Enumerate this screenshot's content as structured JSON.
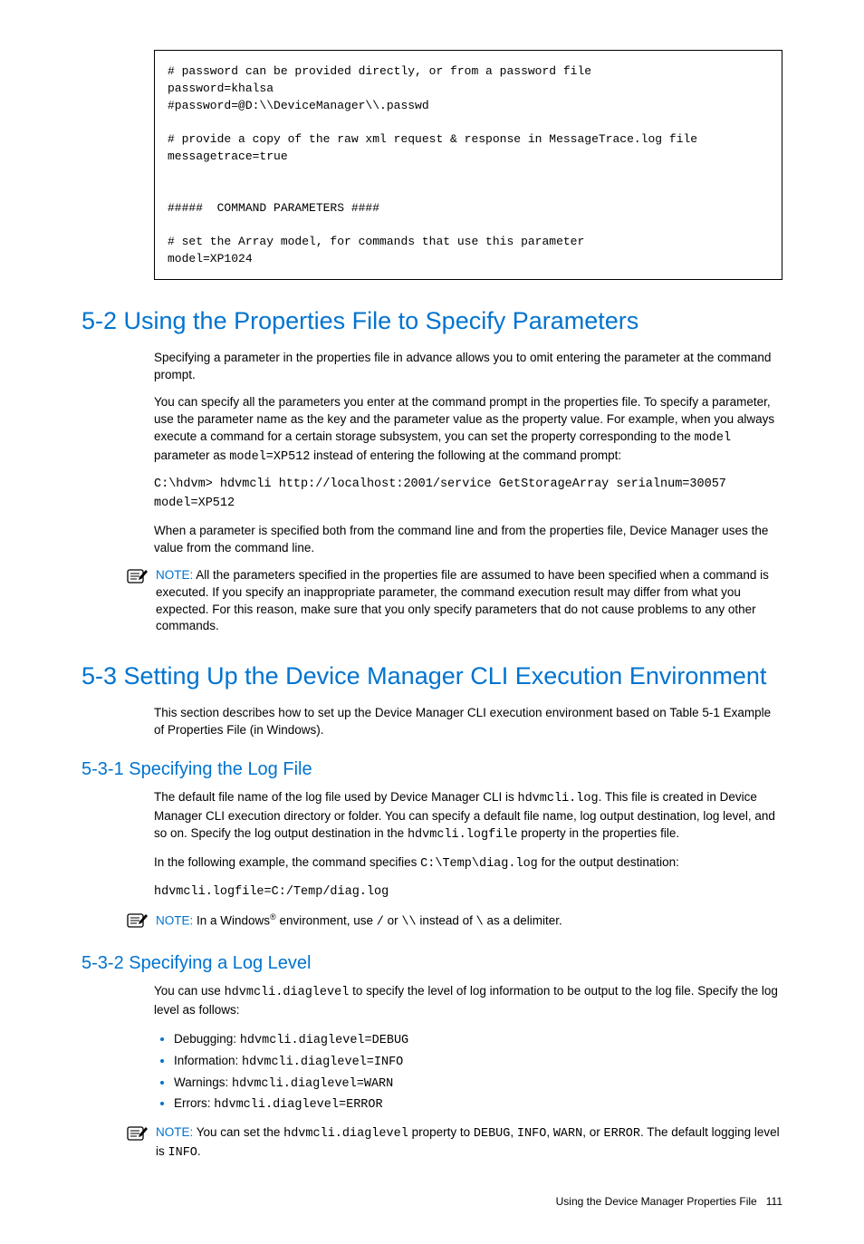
{
  "codebox": "# password can be provided directly, or from a password file\npassword=khalsa\n#password=@D:\\\\DeviceManager\\\\.passwd\n\n# provide a copy of the raw xml request & response in MessageTrace.log file\nmessagetrace=true\n\n\n#####  COMMAND PARAMETERS ####\n\n# set the Array model, for commands that use this parameter\nmodel=XP1024",
  "h52": "5-2 Using the Properties File to Specify Parameters",
  "p52_1": "Specifying a parameter in the properties file in advance allows you to omit entering the parameter at the command prompt.",
  "p52_2a": "You can specify all the parameters you enter at the command prompt in the properties file. To specify a parameter, use the parameter name as the key and the parameter value as the property value. For example, when you always execute a command for a certain storage subsystem, you can set the property corresponding to the ",
  "p52_2_model": "model",
  "p52_2b": " parameter as ",
  "p52_2_modelval": "model=XP512",
  "p52_2c": " instead of entering the following at the command prompt:",
  "cmd52": "C:\\hdvm> hdvmcli http://localhost:2001/service GetStorageArray serialnum=30057 model=XP512",
  "p52_3": "When a parameter is specified both from the command line and from the properties file, Device Manager uses the value from the command line.",
  "note52_label": "NOTE:  ",
  "note52": "All the parameters specified in the properties file are assumed to have been specified when a command is executed. If you specify an inappropriate parameter, the command execution result may differ from what you expected. For this reason, make sure that you only specify parameters that do not cause problems to any other commands.",
  "h53": "5-3 Setting Up the Device Manager CLI Execution Environment",
  "p53_1": "This section describes how to set up the Device Manager CLI execution environment based on Table 5-1 Example of Properties File (in Windows).",
  "h531": "5-3-1 Specifying the Log File",
  "p531_1a": "The default file name of the log file used by Device Manager CLI is ",
  "p531_1_file": "hdvmcli.log",
  "p531_1b": ". This file is created in Device Manager CLI execution directory or folder. You can specify a default file name, log output destination, log level, and so on. Specify the log output destination in the ",
  "p531_1_prop": "hdvmcli.logfile",
  "p531_1c": " property in the properties file.",
  "p531_2a": "In the following example, the command specifies ",
  "p531_2_path": "C:\\Temp\\diag.log",
  "p531_2b": " for the output destination:",
  "cmd531": "hdvmcli.logfile=C:/Temp/diag.log",
  "note531_label": "NOTE:  ",
  "note531_a": "In a Windows",
  "note531_sup": "®",
  "note531_b": " environment, use ",
  "note531_s1": "/",
  "note531_c": " or ",
  "note531_s2": "\\\\",
  "note531_d": " instead of ",
  "note531_s3": "\\",
  "note531_e": " as a delimiter.",
  "h532": "5-3-2 Specifying a Log Level",
  "p532_1a": "You can use ",
  "p532_1_prop": "hdvmcli.diaglevel",
  "p532_1b": " to specify the level of log information to be output to the log file. Specify the log level as follows:",
  "bullets": {
    "0": {
      "label": "Debugging: ",
      "code": "hdvmcli.diaglevel=DEBUG"
    },
    "1": {
      "label": "Information: ",
      "code": "hdvmcli.diaglevel=INFO"
    },
    "2": {
      "label": "Warnings: ",
      "code": "hdvmcli.diaglevel=WARN"
    },
    "3": {
      "label": "Errors: ",
      "code": "hdvmcli.diaglevel=ERROR"
    }
  },
  "note532_label": "NOTE:  ",
  "note532_a": "You can set the ",
  "note532_prop": "hdvmcli.diaglevel",
  "note532_b": " property to ",
  "note532_v1": "DEBUG",
  "note532_c": ", ",
  "note532_v2": "INFO",
  "note532_d": ", ",
  "note532_v3": "WARN",
  "note532_e": ", or ",
  "note532_v4": "ERROR",
  "note532_f": ". The default logging level is ",
  "note532_v5": "INFO",
  "note532_g": ".",
  "footer_text": "Using the Device Manager Properties File",
  "footer_page": "111"
}
